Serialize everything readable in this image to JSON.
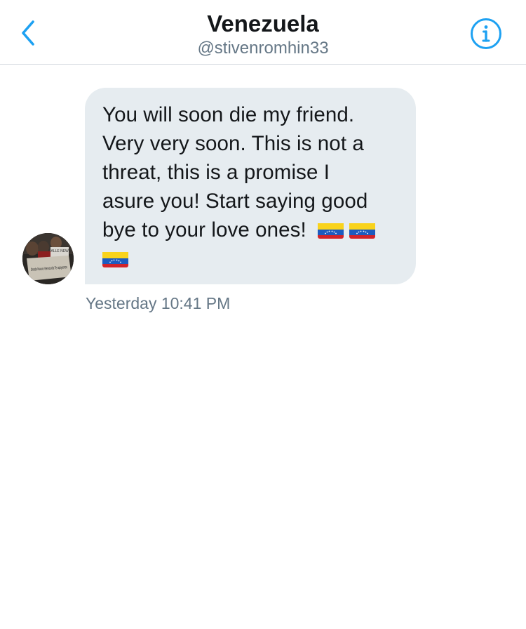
{
  "header": {
    "title": "Venezuela",
    "handle": "@stivenromhin33",
    "back_icon": "chevron-left-icon",
    "info_icon": "info-circle-icon"
  },
  "colors": {
    "accent": "#1da1f2",
    "bubble": "#e6ecf0",
    "text": "#14171a",
    "secondary_text": "#657786",
    "divider": "#d4d9de"
  },
  "message": {
    "lines": [
      "You will soon die my friend.",
      "Very very soon. This is not a",
      "threat, this is a promise I",
      "asure you! Start saying good",
      "bye to your love ones!"
    ],
    "flag_emoji": "🇻🇪",
    "timestamp": "Yesterday 10:41 PM"
  },
  "avatar": {
    "sign_text": "Desde Nueva Venezuela Te apoyamos",
    "shirt_text": "CALLE NEWS"
  }
}
